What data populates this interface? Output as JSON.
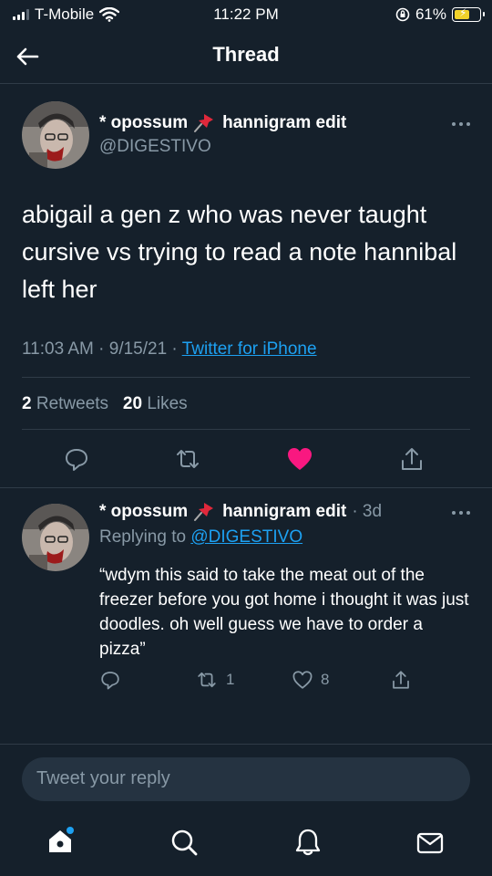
{
  "status_bar": {
    "carrier": "T-Mobile",
    "time": "11:22 PM",
    "battery": "61%"
  },
  "header": {
    "title": "Thread"
  },
  "tweet": {
    "author_name": "* opossum",
    "author_name_suffix": "hannigram edit",
    "author_handle": "@DIGESTIVO",
    "text": "abigail a gen z who was never taught cursive vs trying to read a note hannibal left her",
    "time": "11:03 AM · 9/15/21 · ",
    "source": "Twitter for iPhone",
    "retweets_count": "2",
    "retweets_label": "Retweets",
    "likes_count": "20",
    "likes_label": "Likes"
  },
  "reply": {
    "author_name": "* opossum",
    "author_name_suffix": "hannigram edit",
    "age": "· 3d",
    "replying_prefix": "Replying to ",
    "replying_to": "@DIGESTIVO",
    "text": "“wdym this said to take the meat out of the freezer before you got home i thought it was just doodles. oh well guess we have to order a pizza”",
    "retweets": "1",
    "likes": "8"
  },
  "composer": {
    "placeholder": "Tweet your reply"
  },
  "colors": {
    "background": "#15202b",
    "accent": "#1da1f2",
    "like": "#f91880",
    "muted": "#8899a6"
  },
  "icons": [
    "back-arrow-icon",
    "more-icon",
    "reply-icon",
    "retweet-icon",
    "heart-icon",
    "share-icon",
    "home-icon",
    "search-icon",
    "bell-icon",
    "mail-icon",
    "pin-icon"
  ]
}
